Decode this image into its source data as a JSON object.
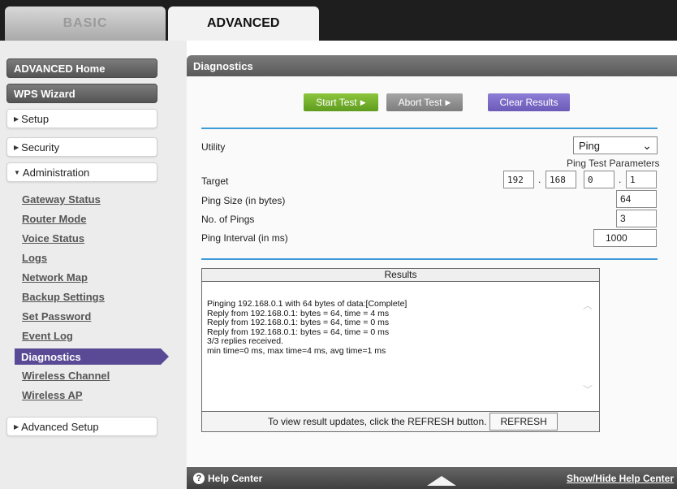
{
  "tabs": {
    "basic": "BASIC",
    "advanced": "ADVANCED"
  },
  "sidebar": {
    "advanced_home": "ADVANCED Home",
    "wps_wizard": "WPS Wizard",
    "setup": "Setup",
    "security": "Security",
    "administration": "Administration",
    "admin_items": [
      "Gateway Status",
      "Router Mode",
      "Voice Status",
      "Logs",
      "Network Map",
      "Backup Settings",
      "Set Password",
      "Event Log",
      "Diagnostics",
      "Wireless Channel",
      "Wireless AP"
    ],
    "advanced_setup": "Advanced Setup"
  },
  "page": {
    "title": "Diagnostics",
    "buttons": {
      "start": "Start Test",
      "abort": "Abort Test",
      "clear": "Clear Results"
    },
    "utility_label": "Utility",
    "utility_value": "Ping",
    "ping_params_label": "Ping Test Parameters",
    "target_label": "Target",
    "target_ip": [
      "192",
      "168",
      "0",
      "1"
    ],
    "ping_size_label": "Ping Size (in bytes)",
    "ping_size": "64",
    "num_pings_label": "No. of Pings",
    "num_pings": "3",
    "interval_label": "Ping Interval (in ms)",
    "interval": "1000"
  },
  "results": {
    "title": "Results",
    "lines": "Pinging 192.168.0.1 with 64 bytes of data:[Complete]\nReply from 192.168.0.1: bytes = 64, time = 4 ms\nReply from 192.168.0.1: bytes = 64, time = 0 ms\nReply from 192.168.0.1: bytes = 64, time = 0 ms\n3/3 replies received.\nmin time=0 ms, max time=4 ms, avg time=1 ms",
    "refresh_note": "To view result updates, click the REFRESH button.",
    "refresh_button": "REFRESH"
  },
  "helpbar": {
    "label": "Help Center",
    "toggle": "Show/Hide Help Center"
  },
  "colors": {
    "accent_blue": "#3d9bd7",
    "purple": "#5a4a96",
    "green": "#6fae28"
  }
}
